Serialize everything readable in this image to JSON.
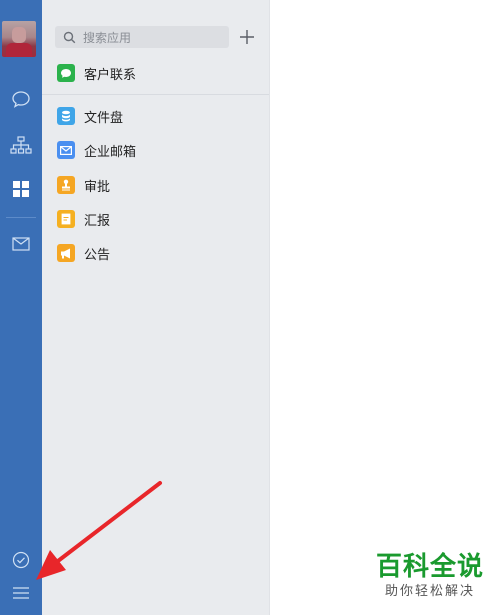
{
  "search": {
    "placeholder": "搜索应用"
  },
  "contacts_item": {
    "label": "客户联系",
    "icon": "chat-bubble-icon",
    "color": "#2bb24c"
  },
  "apps": [
    {
      "label": "文件盘",
      "icon": "database-icon",
      "color": "#3fa5e8"
    },
    {
      "label": "企业邮箱",
      "icon": "envelope-icon",
      "color": "#4a8ff0"
    },
    {
      "label": "审批",
      "icon": "stamp-icon",
      "color": "#f5a623"
    },
    {
      "label": "汇报",
      "icon": "document-icon",
      "color": "#f5b021"
    },
    {
      "label": "公告",
      "icon": "megaphone-icon",
      "color": "#f5a623"
    }
  ],
  "watermark": {
    "title": "百科全说",
    "subtitle": "助你轻松解决"
  },
  "colors": {
    "rail": "#3a6fb6",
    "panel": "#e9ebee",
    "arrow": "#e8262a"
  }
}
